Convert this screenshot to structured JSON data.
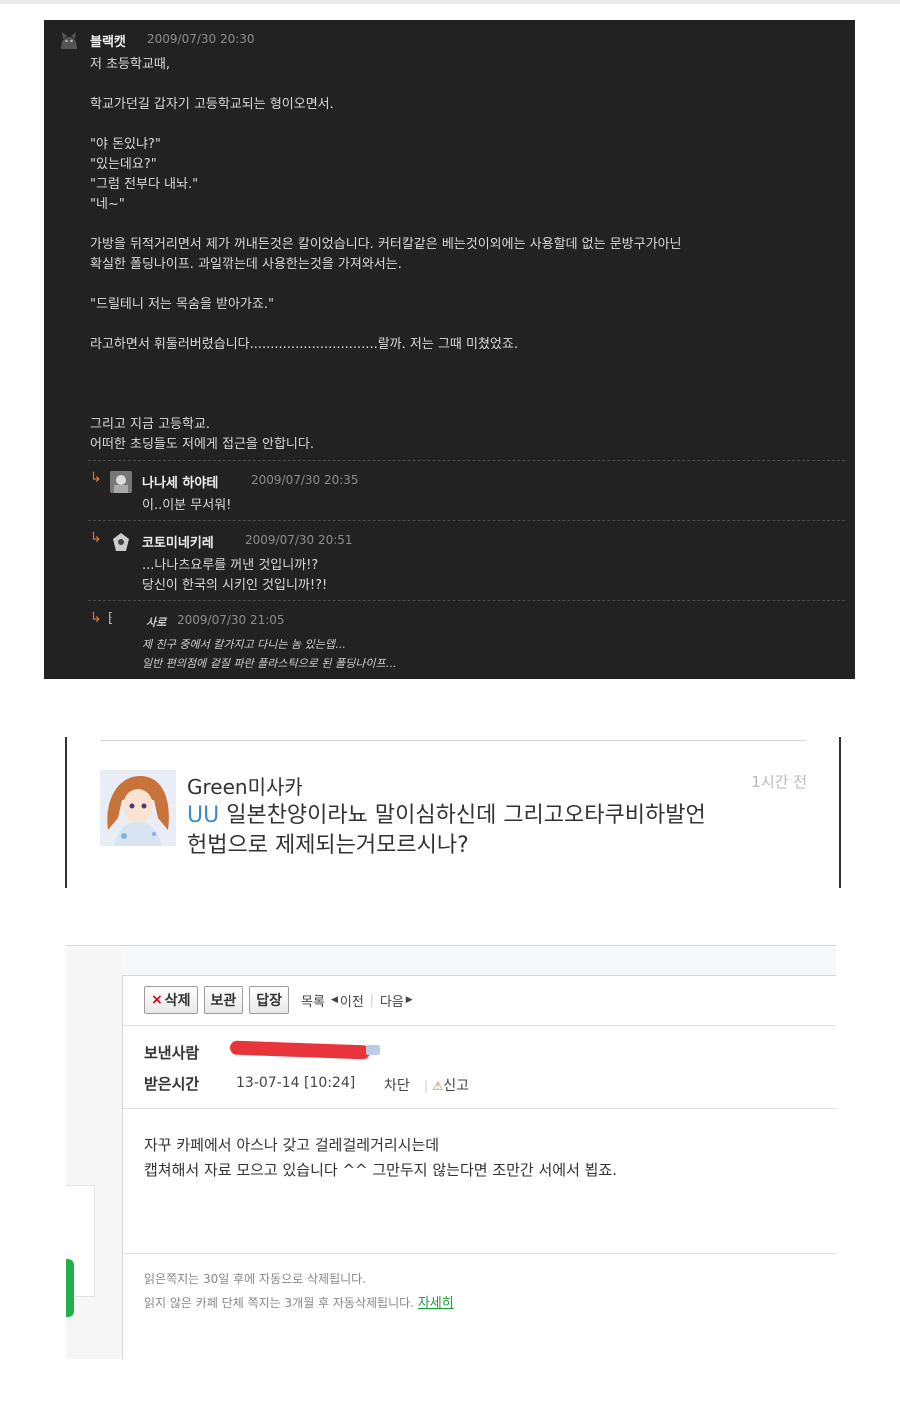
{
  "panel1": {
    "author": "블랙캣",
    "time": "2009/07/30 20:30",
    "lines": [
      "저 초등학교때,",
      "학교가던길 갑자기 고등학교되는 형이오면서.",
      "\"야 돈있냐?\"",
      "\"있는데요?\"",
      "\"그럼 전부다 내놔.\"",
      "\"네~\"",
      "가방을 뒤적거리면서 제가 꺼내든것은 칼이었습니다. 커터칼같은 베는것이외에는 사용할데 없는 문방구가아닌",
      "확실한 폴딩나이프. 과일깎는데 사용한는것을 가져와서는.",
      "\"드릴테니 저는 목숨을 받아가죠.\"",
      "라고하면서 휘둘러버렸습니다...............................랄까. 저는 그때 미쳤었죠.",
      "그리고 지금 고등학교.",
      "어떠한 초딩들도 저에게 접근을 안합니다."
    ],
    "replies": [
      {
        "author": "나나세 하야테",
        "time": "2009/07/30 20:35",
        "lines": [
          "이..이분 무서워!"
        ]
      },
      {
        "author": "코토미네키레",
        "time": "2009/07/30 20:51",
        "lines": [
          "...나나츠요루를 꺼낸 것입니까!?",
          "당신이 한국의 시키인 것입니까!?!"
        ]
      },
      {
        "author": "사로",
        "time": "2009/07/30 21:05",
        "lines": [
          "제 친구 중에서 칼가지고 다니는 놈 있는뎁...",
          "일반 편의점에 겉질 파란 플라스틱으로 된 폴딩나이프..."
        ]
      }
    ]
  },
  "panel2": {
    "username": "Green미사카",
    "ago": "1시간 전",
    "prefix": "UU",
    "line1": " 일본찬양이라뇨 말이심하신데 그리고오타쿠비하발언",
    "line2": "헌법으로 제제되는거모르시나?"
  },
  "panel3": {
    "toolbar": {
      "delete": "삭제",
      "delete_x": "×",
      "keep": "보관",
      "reply": "답장",
      "list": "목록",
      "prev": "이전",
      "next": "다음"
    },
    "sender_label": "보낸사람",
    "received_label": "받은시간",
    "received_time": "13-07-14 [10:24]",
    "block": "차단",
    "report": "신고",
    "body_lines": [
      "자꾸 카페에서 아스나 갖고 걸레걸레거리시는데",
      "캡쳐해서 자료 모으고 있습니다 ^^ 그만두지 않는다면 조만간 서에서 뵙죠."
    ],
    "notes": [
      "읽은쪽지는 30일 후에 자동으로 삭제됩니다.",
      "읽지 않은 카페 단체 쪽지는 3개월 후 자동삭제됩니다."
    ],
    "detail_link": "자세히"
  },
  "colors": {
    "dark_bg": "#222222",
    "reply_arrow": "#e07a30",
    "comment_prefix": "#3a8ec8",
    "delete_x": "#d0021b",
    "link_green": "#1a9e3a",
    "redaction": "#e8353b"
  }
}
